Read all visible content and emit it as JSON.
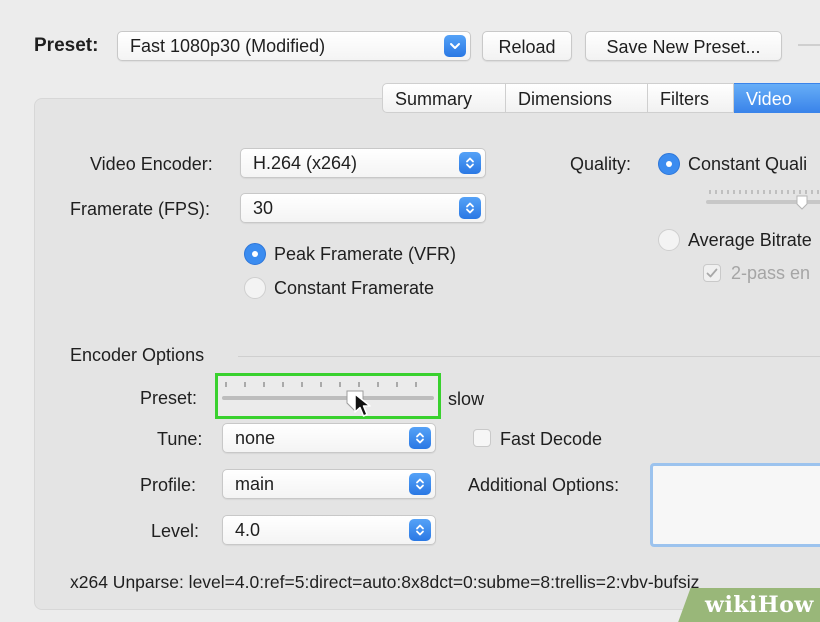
{
  "colors": {
    "accent": "#3b8cf0",
    "highlight": "#39d12e",
    "window_bg": "#ececec",
    "panel_bg": "#e4e4e4"
  },
  "header": {
    "preset_label": "Preset:",
    "preset_value": "Fast 1080p30 (Modified)",
    "reload_label": "Reload",
    "save_new_preset_label": "Save New Preset..."
  },
  "tabs": [
    {
      "label": "Summary",
      "active": false
    },
    {
      "label": "Dimensions",
      "active": false
    },
    {
      "label": "Filters",
      "active": false
    },
    {
      "label": "Video",
      "active": true
    }
  ],
  "video": {
    "encoder_label": "Video Encoder:",
    "encoder_value": "H.264 (x264)",
    "framerate_label": "Framerate (FPS):",
    "framerate_value": "30",
    "peak_framerate_label": "Peak Framerate (VFR)",
    "constant_framerate_label": "Constant Framerate",
    "quality_label": "Quality:",
    "constant_quality_label": "Constant Quali",
    "average_bitrate_label": "Average Bitrate",
    "two_pass_label": "2-pass en"
  },
  "encoder_options": {
    "section_label": "Encoder Options",
    "preset_label": "Preset:",
    "preset_slider_value_label": "slow",
    "tune_label": "Tune:",
    "tune_value": "none",
    "fast_decode_label": "Fast Decode",
    "profile_label": "Profile:",
    "profile_value": "main",
    "additional_options_label": "Additional Options:",
    "level_label": "Level:",
    "level_value": "4.0",
    "unparse_text": "x264 Unparse: level=4.0:ref=5:direct=auto:8x8dct=0:subme=8:trellis=2:vbv-bufsiz"
  },
  "watermark": {
    "text_wiki": "wiki",
    "text_how": "How"
  }
}
